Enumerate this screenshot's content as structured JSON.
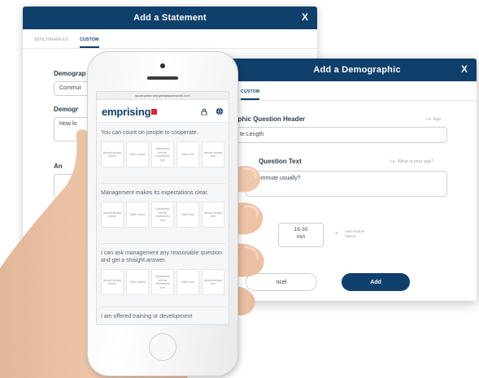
{
  "statement_modal": {
    "title": "Add a Statement",
    "close": "X",
    "tabs": [
      "BENCHMARKED",
      "CUSTOM"
    ],
    "field1_label": "Demograp",
    "field1_value": "Commut",
    "field2_label": "Demogr",
    "field2_value": "How lo",
    "field3_label": "An"
  },
  "demographic_modal": {
    "title": "Add a Demographic",
    "close": "X",
    "tab": "CUSTOM",
    "header_label": "aphic Question Header",
    "header_hint": "i.e. Age",
    "header_value": "te Length",
    "question_label": "Question Text",
    "question_hint": "i.e. What is your age?",
    "question_value": "r commute usually?",
    "option_chip": "16-30\nmin",
    "add_another": "Add Another Option",
    "cancel_label": "ncel",
    "add_label": "Add"
  },
  "phone": {
    "url": "qa-emprisurvey.greatplacetowork.com",
    "logo": "emprising",
    "icons": [
      "lock-icon",
      "globe-icon"
    ],
    "options": [
      "Almost always untrue",
      "Often untrue",
      "Sometimes untrue/ Sometimes true",
      "Often true",
      "Almost always true"
    ],
    "questions": [
      "You can count on people to cooperate.",
      "Management makes its expectations clear.",
      "I can ask management any reasonable question and get a straight answer.",
      "I am offered training or development"
    ]
  },
  "colors": {
    "brand_navy": "#0f3f6b",
    "logo_red": "#d9232d"
  }
}
